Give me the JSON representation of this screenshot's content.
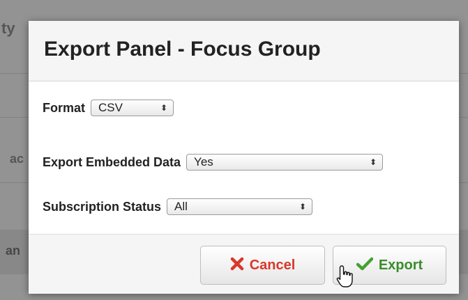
{
  "background": {
    "fragment_top": "ty",
    "fragment_mid": "ac",
    "fragment_low": "an"
  },
  "modal": {
    "title": "Export Panel - Focus Group",
    "fields": [
      {
        "label": "Format",
        "value": "CSV"
      },
      {
        "label": "Export Embedded Data",
        "value": "Yes"
      },
      {
        "label": "Subscription Status",
        "value": "All"
      }
    ],
    "select_arrow_icon": "up-down-arrows-icon",
    "buttons": {
      "cancel": {
        "label": "Cancel",
        "icon": "x-icon",
        "color": "#d8382b"
      },
      "export": {
        "label": "Export",
        "icon": "checkmark-icon",
        "color": "#3a8d2b"
      }
    }
  },
  "cursor_icon": "hand-pointer-icon"
}
